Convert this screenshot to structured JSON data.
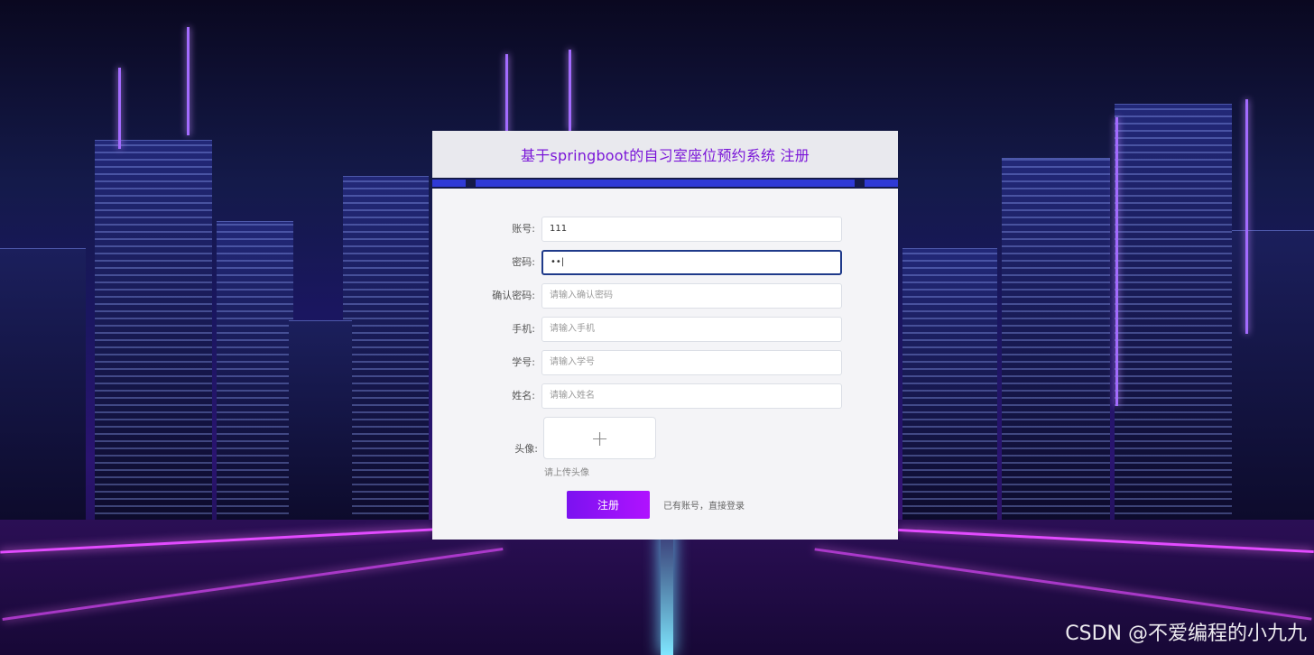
{
  "header": {
    "title": "基于springboot的自习室座位预约系统 注册"
  },
  "form": {
    "fields": [
      {
        "label": "账号:",
        "value": "111",
        "placeholder": ""
      },
      {
        "label": "密码:",
        "value": "••|",
        "placeholder": ""
      },
      {
        "label": "确认密码:",
        "value": "",
        "placeholder": "请输入确认密码"
      },
      {
        "label": "手机:",
        "value": "",
        "placeholder": "请输入手机"
      },
      {
        "label": "学号:",
        "value": "",
        "placeholder": "请输入学号"
      },
      {
        "label": "姓名:",
        "value": "",
        "placeholder": "请输入姓名"
      }
    ],
    "avatar_label": "头像:",
    "upload_icon": "+",
    "upload_tip": "请上传头像",
    "register_label": "注册",
    "login_link": "已有账号，直接登录"
  },
  "watermark": "CSDN @不爱编程的小九九",
  "colors": {
    "accent": "#8a16f0",
    "title": "#7a16d8",
    "focus_border": "#1f3a8a"
  }
}
